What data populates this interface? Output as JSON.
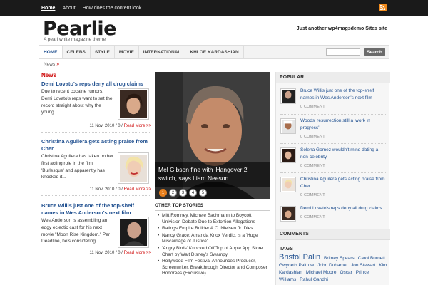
{
  "topnav": [
    "Home",
    "About",
    "How does the content look"
  ],
  "rss_icon": "rss-icon",
  "header": {
    "logo": "Pearlie",
    "tagline": "A pearl white magazine theme",
    "site_description": "Just another wp4magsdemo Sites site"
  },
  "catnav": [
    "HOME",
    "CELEBS",
    "STYLE",
    "MOVIE",
    "INTERNATIONAL",
    "KHLOE KARDASHIAN"
  ],
  "search": {
    "button": "Search",
    "placeholder": ""
  },
  "breadcrumb": "News",
  "news": {
    "heading": "News",
    "posts": [
      {
        "title": "Demi Lovato's reps deny all drug claims",
        "excerpt": "Due to recent cocaine rumors, Demi Lovato's reps want to set the record straight about why the young...",
        "date": "11 Nov, 2010 / 0 /",
        "more": "Read More >>"
      },
      {
        "title": "Christina Aguilera gets acting praise from Cher",
        "excerpt": "Christina Aguilera has taken on her first acting role in the film 'Burlesque' and apparently has knocked it...",
        "date": "11 Nov, 2010 / 0 /",
        "more": "Read More >>"
      },
      {
        "title": "Bruce Willis just one of the top-shelf names in Wes Anderson's next film",
        "excerpt": "Wes Anderson is assembling an edgy eclectic cast for his next movie \"Moon Rise Kingdom.\" Per Deadline, he's considering...",
        "date": "11 Nov, 2010 / 0 /",
        "more": "Read More >>"
      }
    ]
  },
  "featured": {
    "caption": "Mel Gibson fine with 'Hangover 2' switch, says Liam Neeson",
    "dots": [
      "1",
      "2",
      "3",
      "4",
      "5"
    ],
    "active": 0
  },
  "other_top_stories": {
    "heading": "OTHER TOP STORIES",
    "items": [
      "Mitt Romney, Michele Bachmann to Boycott Univision Debate Due to Extortion Allegations",
      "Ratings Empire Builder A.C. Nielsen Jr. Dies",
      "Nancy Grace: Amanda Knox Verdict Is a 'Huge Miscarriage of Justice'",
      "'Angry Birds' Knocked Off Top of Apple App Store Chart by Walt Disney's Swampy",
      "Hollywood Film Festival Announces Producer, Screenwriter, Breakthrough Director and Composer Honorees (Exclusive)"
    ]
  },
  "sidebar": {
    "popular_heading": "POPULAR",
    "popular": [
      {
        "title": "Bruce Willis just one of the top-shelf names in Wes Anderson's next film",
        "comments": "0 COMMENT"
      },
      {
        "title": "Woods' resurrection still a 'work in progress'",
        "comments": "0 COMMENT"
      },
      {
        "title": "Selena Gomez wouldn't mind dating a non-celebrity",
        "comments": "0 COMMENT"
      },
      {
        "title": "Christina Aguilera gets acting praise from Cher",
        "comments": "0 COMMENT"
      },
      {
        "title": "Demi Lovato's reps deny all drug claims",
        "comments": "0 COMMENT"
      }
    ],
    "comments_heading": "COMMENTS",
    "tags_heading": "TAGS",
    "tags": [
      "Bristol Palin",
      "Britney Spears",
      "Carol Burnett",
      "Gwyneth Paltrow",
      "John Duhamel",
      "Jon Stewart",
      "Kim Kardashian",
      "Michael Moore",
      "Oscar",
      "Prince Williams",
      "Rahul Gandhi"
    ],
    "big_tag": "Bristol Palin"
  },
  "colors": {
    "accent_red": "#cc0000",
    "link_blue": "#1f4f8f",
    "slider_active": "#e8801e"
  }
}
